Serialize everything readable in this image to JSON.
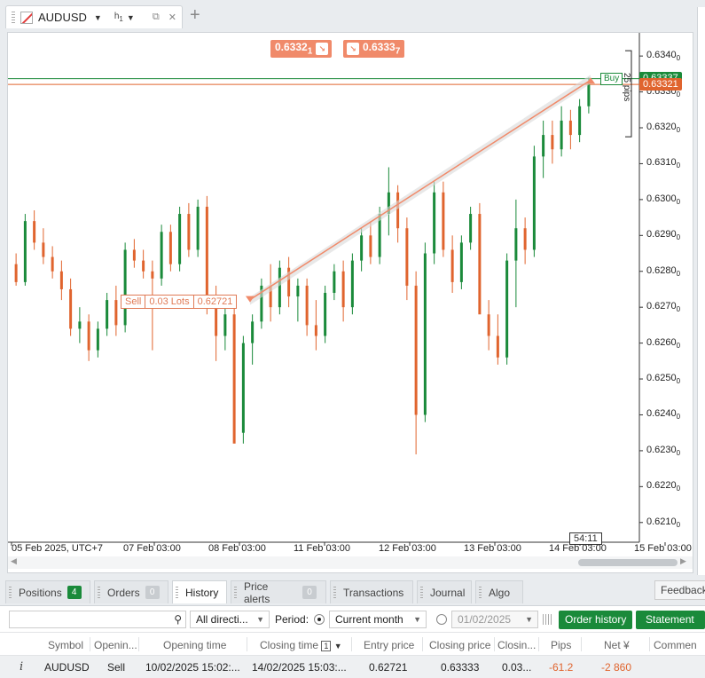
{
  "chart_tab": {
    "symbol": "AUDUSD",
    "timeframe": "h",
    "timeframe_sub": "1"
  },
  "price_boxes": {
    "sell": "0.6332",
    "sell_sub": "1",
    "buy": "0.6333",
    "buy_sub": "7"
  },
  "price_axis": {
    "labels": [
      {
        "v": 0.634,
        "t": "0.6340",
        "s": "0"
      },
      {
        "v": 0.633,
        "t": "0.6330",
        "s": "0"
      },
      {
        "v": 0.632,
        "t": "0.6320",
        "s": "0"
      },
      {
        "v": 0.631,
        "t": "0.6310",
        "s": "0"
      },
      {
        "v": 0.63,
        "t": "0.6300",
        "s": "0"
      },
      {
        "v": 0.629,
        "t": "0.6290",
        "s": "0"
      },
      {
        "v": 0.628,
        "t": "0.6280",
        "s": "0"
      },
      {
        "v": 0.627,
        "t": "0.6270",
        "s": "0"
      },
      {
        "v": 0.626,
        "t": "0.6260",
        "s": "0"
      },
      {
        "v": 0.625,
        "t": "0.6250",
        "s": "0"
      },
      {
        "v": 0.624,
        "t": "0.6240",
        "s": "0"
      },
      {
        "v": 0.623,
        "t": "0.6230",
        "s": "0"
      },
      {
        "v": 0.622,
        "t": "0.6220",
        "s": "0"
      },
      {
        "v": 0.621,
        "t": "0.6210",
        "s": "0"
      }
    ],
    "ask_tag": "0.63337",
    "bid_tag": "0.63321",
    "pips_label": "25 pips"
  },
  "time_axis": [
    "05 Feb 2025, UTC+7",
    "07 Feb 03:00",
    "08 Feb 03:00",
    "11 Feb 03:00",
    "12 Feb 03:00",
    "13 Feb 03:00",
    "14 Feb 03:00",
    "15 Feb 03:00"
  ],
  "timer": "54:11",
  "sell_tag": {
    "side": "Sell",
    "lots": "0.03 Lots",
    "price": "0.62721"
  },
  "buy_tag": "Buy",
  "colors": {
    "up": "#1a8a3a",
    "down": "#e0642e",
    "trade_line": "#f08a6a",
    "ask_line": "#1a8a3a",
    "bid_line": "#e0642e"
  },
  "chart_data": {
    "type": "candlestick",
    "ylim": [
      0.6205,
      0.6343
    ],
    "entry": {
      "x": 0.348,
      "y": 0.62721
    },
    "exit": {
      "x": 0.861,
      "y": 0.63333
    },
    "candles": [
      [
        0.6282,
        0.6285,
        0.6276,
        0.6277
      ],
      [
        0.6277,
        0.6296,
        0.6276,
        0.6294
      ],
      [
        0.6294,
        0.6297,
        0.6286,
        0.6288
      ],
      [
        0.6288,
        0.6292,
        0.6282,
        0.6284
      ],
      [
        0.6284,
        0.6287,
        0.6278,
        0.628
      ],
      [
        0.628,
        0.6283,
        0.6272,
        0.6275
      ],
      [
        0.6275,
        0.6278,
        0.6262,
        0.6264
      ],
      [
        0.6264,
        0.627,
        0.626,
        0.6266
      ],
      [
        0.6266,
        0.6268,
        0.6255,
        0.6258
      ],
      [
        0.6258,
        0.6266,
        0.6256,
        0.6264
      ],
      [
        0.6264,
        0.6274,
        0.6262,
        0.6272
      ],
      [
        0.6272,
        0.6276,
        0.6262,
        0.6265
      ],
      [
        0.6265,
        0.6288,
        0.6263,
        0.6286
      ],
      [
        0.6286,
        0.6289,
        0.6281,
        0.6283
      ],
      [
        0.6283,
        0.6286,
        0.6278,
        0.628
      ],
      [
        0.628,
        0.6283,
        0.6258,
        0.6278
      ],
      [
        0.6278,
        0.6293,
        0.6276,
        0.6291
      ],
      [
        0.6291,
        0.6293,
        0.628,
        0.6282
      ],
      [
        0.6282,
        0.6298,
        0.628,
        0.6296
      ],
      [
        0.6296,
        0.6299,
        0.6284,
        0.6286
      ],
      [
        0.6286,
        0.63,
        0.6284,
        0.6298
      ],
      [
        0.6298,
        0.6301,
        0.6268,
        0.6272
      ],
      [
        0.6272,
        0.6276,
        0.6255,
        0.6262
      ],
      [
        0.6262,
        0.627,
        0.6258,
        0.6268
      ],
      [
        0.6268,
        0.627,
        0.624,
        0.6232
      ],
      [
        0.6235,
        0.6262,
        0.6232,
        0.626
      ],
      [
        0.626,
        0.6268,
        0.6254,
        0.6266
      ],
      [
        0.6266,
        0.6278,
        0.6264,
        0.6276
      ],
      [
        0.6276,
        0.6282,
        0.6266,
        0.627
      ],
      [
        0.627,
        0.6283,
        0.6268,
        0.6281
      ],
      [
        0.6281,
        0.6284,
        0.627,
        0.6273
      ],
      [
        0.6273,
        0.6278,
        0.6266,
        0.6276
      ],
      [
        0.6276,
        0.6278,
        0.6262,
        0.6265
      ],
      [
        0.6265,
        0.6272,
        0.6258,
        0.6262
      ],
      [
        0.6262,
        0.6276,
        0.626,
        0.6274
      ],
      [
        0.6274,
        0.6282,
        0.6272,
        0.628
      ],
      [
        0.628,
        0.6283,
        0.6266,
        0.627
      ],
      [
        0.627,
        0.6285,
        0.6268,
        0.6283
      ],
      [
        0.6283,
        0.6292,
        0.628,
        0.629
      ],
      [
        0.629,
        0.6294,
        0.6282,
        0.6284
      ],
      [
        0.6284,
        0.6298,
        0.6282,
        0.6296
      ],
      [
        0.6296,
        0.6309,
        0.629,
        0.6302
      ],
      [
        0.6302,
        0.6304,
        0.6288,
        0.6292
      ],
      [
        0.6292,
        0.6295,
        0.6272,
        0.6276
      ],
      [
        0.6276,
        0.628,
        0.6229,
        0.624
      ],
      [
        0.624,
        0.6288,
        0.6238,
        0.6285
      ],
      [
        0.6285,
        0.6305,
        0.6282,
        0.6302
      ],
      [
        0.6302,
        0.6305,
        0.6284,
        0.6286
      ],
      [
        0.6286,
        0.629,
        0.6274,
        0.6277
      ],
      [
        0.6277,
        0.629,
        0.6275,
        0.6288
      ],
      [
        0.6288,
        0.6298,
        0.6286,
        0.6296
      ],
      [
        0.6296,
        0.6299,
        0.6272,
        0.6268
      ],
      [
        0.6268,
        0.6272,
        0.6258,
        0.6262
      ],
      [
        0.6262,
        0.6268,
        0.6254,
        0.6256
      ],
      [
        0.6256,
        0.6285,
        0.6254,
        0.6283
      ],
      [
        0.6283,
        0.63,
        0.627,
        0.6292
      ],
      [
        0.6292,
        0.6295,
        0.6282,
        0.6286
      ],
      [
        0.6286,
        0.6315,
        0.6284,
        0.6312
      ],
      [
        0.6312,
        0.6322,
        0.6306,
        0.6318
      ],
      [
        0.6318,
        0.6322,
        0.631,
        0.6314
      ],
      [
        0.6314,
        0.6326,
        0.6312,
        0.6322
      ],
      [
        0.6322,
        0.6325,
        0.6314,
        0.6318
      ],
      [
        0.6318,
        0.6328,
        0.6316,
        0.6326
      ],
      [
        0.6326,
        0.6334,
        0.6324,
        0.6332
      ]
    ]
  },
  "bottom_tabs": [
    {
      "label": "Positions",
      "badge": "4",
      "badge_green": true
    },
    {
      "label": "Orders",
      "badge": "0",
      "badge_green": false
    },
    {
      "label": "History",
      "badge": "",
      "badge_green": false
    },
    {
      "label": "Price alerts",
      "badge": "0",
      "badge_green": false
    },
    {
      "label": "Transactions",
      "badge": "",
      "badge_green": false
    },
    {
      "label": "Journal",
      "badge": "",
      "badge_green": false
    },
    {
      "label": "Algo",
      "badge": "",
      "badge_green": false
    }
  ],
  "feedback": "Feedback",
  "filters": {
    "direction": "All directi...",
    "period_label": "Period:",
    "current_month": "Current month",
    "date": "01/02/2025",
    "order_history": "Order history",
    "statement": "Statement"
  },
  "history_table": {
    "columns": [
      "Symbol",
      "Openin...",
      "Opening time",
      "Closing time",
      "Entry price",
      "Closing price",
      "Closin...",
      "Pips",
      "Net ¥",
      "Commen"
    ],
    "sort_badge": "1",
    "rows": [
      [
        "AUDUSD",
        "Sell",
        "10/02/2025 15:02:...",
        "14/02/2025 15:03:...",
        "0.62721",
        "0.63333",
        "0.03...",
        "-61.2",
        "-2 860",
        ""
      ]
    ]
  }
}
